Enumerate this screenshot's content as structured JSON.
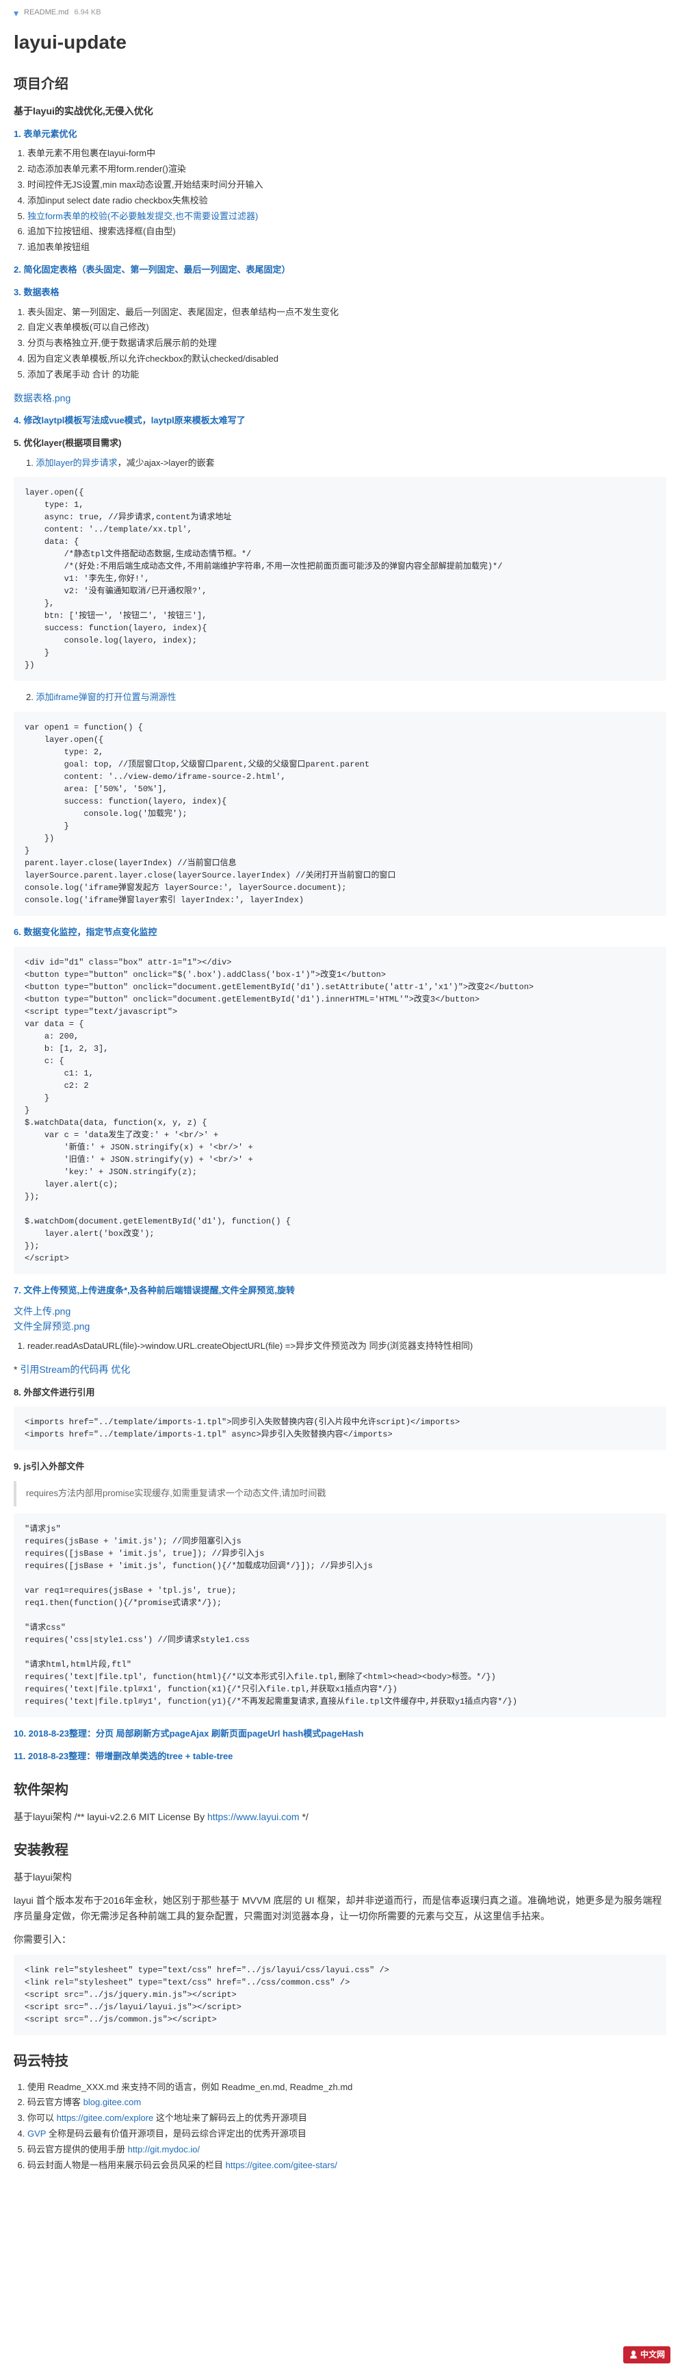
{
  "tabbar": {
    "file": "README.md",
    "stats": "6.94 KB"
  },
  "title": "layui-update",
  "sec_intro": {
    "heading": "项目介绍",
    "text": "基于layui的实战优化,无侵入优化"
  },
  "s1": {
    "head": "1. 表单元素优化",
    "items": [
      "表单元素不用包裹在layui-form中",
      "动态添加表单元素不用form.render()渲染",
      "时间控件无JS设置,min max动态设置,开始结束时间分开输入",
      "添加input select date radio checkbox失焦校验",
      "独立form表单的校验(不必要触发提交,也不需要设置过滤器)",
      "追加下拉按钮组、搜索选择框(自由型)",
      "追加表单按钮组"
    ]
  },
  "s2": {
    "head": "2. 简化固定表格（表头固定、第一列固定、最后一列固定、表尾固定）"
  },
  "s3": {
    "head": "3. 数据表格",
    "items": [
      "表头固定、第一列固定、最后一列固定、表尾固定，但表单结构一点不发生变化",
      "自定义表单模板(可以自己修改)",
      "分页与表格独立开,便于数据请求后展示前的处理",
      "因为自定义表单模板,所以允许checkbox的默认checked/disabled",
      "添加了表尾手动 合计 的功能"
    ],
    "link": "数据表格.png"
  },
  "s4": {
    "head": "4. 修改laytpl模板写法成vue模式，laytpl原来模板太难写了"
  },
  "s5": {
    "head": "5. 优化layer(根据项目需求)",
    "sub1": {
      "idx": "1.",
      "text": "添加layer的异步请求",
      "tail": "，减少ajax->layer的嵌套"
    },
    "code1": "layer.open({\n    type: 1,\n    async: true, //异步请求,content为请求地址\n    content: '../template/xx.tpl',\n    data: {\n        /*静态tpl文件搭配动态数据,生成动态情节框。*/\n        /*(好处:不用后端生成动态文件,不用前端维护字符串,不用一次性把前面页面可能涉及的弹窗内容全部解提前加载完)*/\n        v1: '李先生,你好!',\n        v2: '没有骗通知取消/已开通权限?',\n    },\n    btn: ['按钮一', '按钮二', '按钮三'],\n    success: function(layero, index){\n        console.log(layero, index);\n    }\n})",
    "sub2": {
      "idx": "2.",
      "text": "添加iframe弹窗的打开位置与溯源性"
    },
    "code2": "var open1 = function() {\n    layer.open({\n        type: 2,\n        goal: top, //顶层窗口top,父级窗口parent,父级的父级窗口parent.parent\n        content: '../view-demo/iframe-source-2.html',\n        area: ['50%', '50%'],\n        success: function(layero, index){\n            console.log('加载完');\n        }\n    })\n}\nparent.layer.close(layerIndex) //当前窗口信息\nlayerSource.parent.layer.close(layerSource.layerIndex) //关闭打开当前窗口的窗口\nconsole.log('iframe弹窗发起方 layerSource:', layerSource.document);\nconsole.log('iframe弹窗layer索引 layerIndex:', layerIndex)"
  },
  "s6": {
    "head": "6. 数据变化监控，指定节点变化监控",
    "code": "<div id=\"d1\" class=\"box\" attr-1=\"1\"></div>\n<button type=\"button\" onclick=\"$('.box').addClass('box-1')\">改变1</button>\n<button type=\"button\" onclick=\"document.getElementById('d1').setAttribute('attr-1','x1')\">改变2</button>\n<button type=\"button\" onclick=\"document.getElementById('d1').innerHTML='HTML'\">改变3</button>\n<script type=\"text/javascript\">\nvar data = {\n    a: 200,\n    b: [1, 2, 3],\n    c: {\n        c1: 1,\n        c2: 2\n    }\n}\n$.watchData(data, function(x, y, z) {\n    var c = 'data发生了改变:' + '<br/>' +\n        '新值:' + JSON.stringify(x) + '<br/>' +\n        '旧值:' + JSON.stringify(y) + '<br/>' +\n        'key:' + JSON.stringify(z);\n    layer.alert(c);\n});\n\n$.watchDom(document.getElementById('d1'), function() {\n    layer.alert('box改变');\n});\n</script>"
  },
  "s7": {
    "head": "7. 文件上传预览,上传进度条*,及各种前后端错误提醒,文件全屏预览,旋转",
    "link1": "文件上传.png",
    "link2": "文件全屏预览.png",
    "bullets": [
      "reader.readAsDataURL(file)->window.URL.createObjectURL(file) =>异步文件预览改为 同步(浏览器支持特性相同)"
    ],
    "stream": {
      "star": "*",
      "link": "引用Stream的代码再 优化"
    }
  },
  "s8": {
    "head": "8. 外部文件进行引用",
    "code": "<imports href=\"../template/imports-1.tpl\">同步引入失败替换内容(引入片段中允许script)</imports>\n<imports href=\"../template/imports-1.tpl\" async>异步引入失败替换内容</imports>"
  },
  "s9": {
    "head": "9. js引入外部文件",
    "quote": "requires方法内部用promise实现缓存,如需重复请求一个动态文件,请加时间戳",
    "code": "\"请求js\"\nrequires(jsBase + 'imit.js'); //同步阻塞引入js\nrequires([jsBase + 'imit.js', true]); //异步引入js\nrequires([jsBase + 'imit.js', function(){/*加载成功回调*/}]); //异步引入js\n\nvar req1=requires(jsBase + 'tpl.js', true);\nreq1.then(function(){/*promise式请求*/});\n\n\"请求css\"\nrequires('css|style1.css') //同步请求style1.css\n\n\"请求html,html片段,ftl\"\nrequires('text|file.tpl', function(html){/*以文本形式引入file.tpl,删除了<html><head><body>标签。*/})\nrequires('text|file.tpl#x1', function(x1){/*只引入file.tpl,并获取x1插点内容*/})\nrequires('text|file.tpl#y1', function(y1){/*不再发起需重复请求,直接从file.tpl文件缓存中,并获取y1插点内容*/})"
  },
  "s10": {
    "head": "10. 2018-8-23整理：分页 局部刷新方式pageAjax 刷新页面pageUrl hash模式pageHash"
  },
  "s11": {
    "head": "11. 2018-8-23整理：带增删改单类选的tree + table-tree"
  },
  "arch": {
    "head": "软件架构",
    "pre": "基于layui架构 /** layui-v2.2.6 MIT License By ",
    "link": "https://www.layui.com",
    "post": " */"
  },
  "install": {
    "head": "安装教程",
    "line1": "基于layui架构",
    "para": "layui 首个版本发布于2016年金秋，她区别于那些基于 MVVM 底层的 UI 框架，却并非逆道而行，而是信奉返璞归真之道。准确地说，她更多是为服务端程序员量身定做，你无需涉足各种前端工具的复杂配置，只需面对浏览器本身，让一切你所需要的元素与交互，从这里信手拈来。",
    "line2": "你需要引入：",
    "code": "<link rel=\"stylesheet\" type=\"text/css\" href=\"../js/layui/css/layui.css\" />\n<link rel=\"stylesheet\" type=\"text/css\" href=\"../css/common.css\" />\n<script src=\"../js/jquery.min.js\"></script>\n<script src=\"../js/layui/layui.js\"></script>\n<script src=\"../js/common.js\"></script>"
  },
  "tricks": {
    "head": "码云特技",
    "items": [
      {
        "text": "使用 Readme_XXX.md 来支持不同的语言，例如 Readme_en.md, Readme_zh.md"
      },
      {
        "text": "码云官方博客 ",
        "link": "blog.gitee.com"
      },
      {
        "text": "你可以 ",
        "link": "https://gitee.com/explore",
        "tail": " 这个地址来了解码云上的优秀开源项目"
      },
      {
        "link": "GVP",
        "text2": " 全称是码云最有价值开源项目，是码云综合评定出的优秀开源项目"
      },
      {
        "text": "码云官方提供的使用手册 ",
        "link": "http://git.mydoc.io/"
      },
      {
        "text": "码云封面人物是一档用来展示码云会员风采的栏目 ",
        "link": "https://gitee.com/gitee-stars/"
      }
    ]
  },
  "footer_logo": "中文网"
}
